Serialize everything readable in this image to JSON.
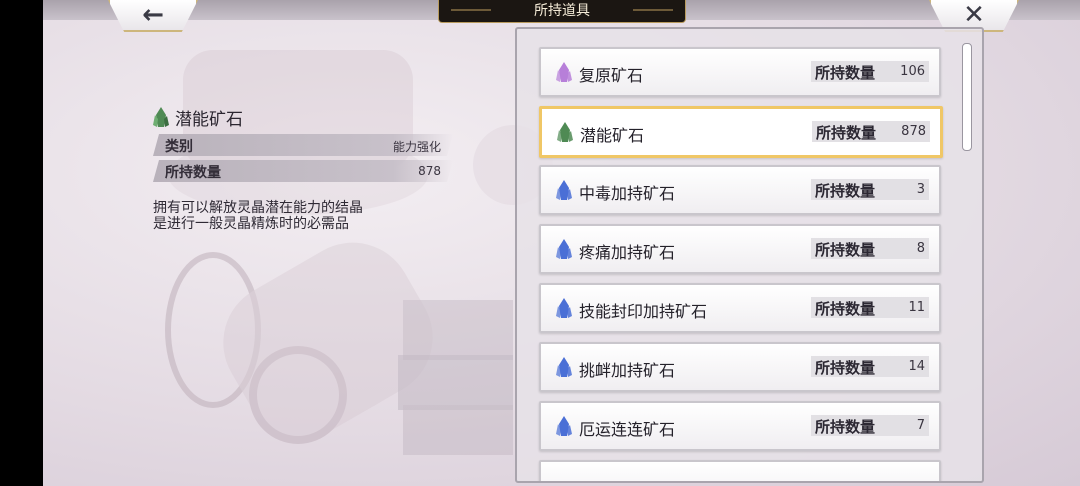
{
  "header": {
    "title": "所持道具",
    "back_icon": "←",
    "close_icon": "✕"
  },
  "detail": {
    "name": "潜能矿石",
    "icon": "green-crystal-icon",
    "rows": [
      {
        "label": "类别",
        "value": "能力强化"
      },
      {
        "label": "所持数量",
        "value": "878"
      }
    ],
    "description": [
      "拥有可以解放灵晶潜在能力的结晶",
      "是进行一般灵晶精炼时的必需品"
    ]
  },
  "list": {
    "count_label": "所持数量",
    "items": [
      {
        "name": "复原矿石",
        "count": "106",
        "icon": "purple-crystal-icon",
        "color": "#b77fd9"
      },
      {
        "name": "潜能矿石",
        "count": "878",
        "icon": "green-crystal-icon",
        "color": "#4f8a54",
        "selected": true
      },
      {
        "name": "中毒加持矿石",
        "count": "3",
        "icon": "blue-crystal-icon",
        "color": "#4a6fd6"
      },
      {
        "name": "疼痛加持矿石",
        "count": "8",
        "icon": "blue-crystal-icon",
        "color": "#4a6fd6"
      },
      {
        "name": "技能封印加持矿石",
        "count": "11",
        "icon": "blue-crystal-icon",
        "color": "#4a6fd6"
      },
      {
        "name": "挑衅加持矿石",
        "count": "14",
        "icon": "blue-crystal-icon",
        "color": "#4a6fd6"
      },
      {
        "name": "厄运连连矿石",
        "count": "7",
        "icon": "blue-crystal-icon",
        "color": "#4a6fd6"
      }
    ]
  }
}
